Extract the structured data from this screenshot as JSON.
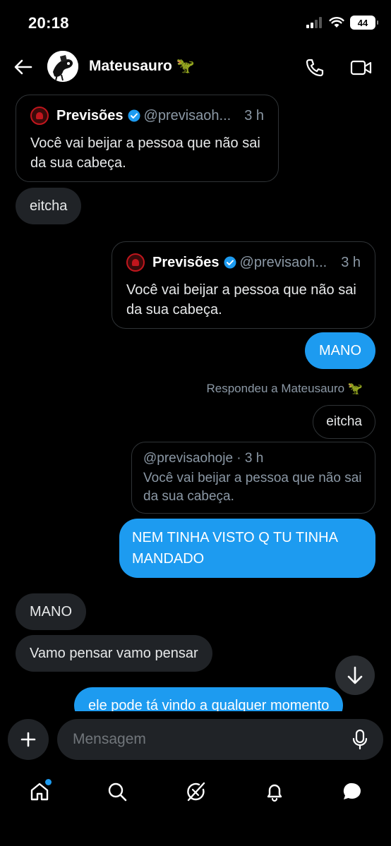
{
  "status_bar": {
    "time": "20:18",
    "battery": "44"
  },
  "header": {
    "contact_name": "Mateusauro 🦖"
  },
  "messages": {
    "quote1": {
      "name": "Previsões",
      "handle": "@previsaoh...",
      "time": "3 h",
      "text": "Você vai beijar a pessoa que não sai da sua cabeça."
    },
    "in_eitcha": "eitcha",
    "quote2": {
      "name": "Previsões",
      "handle": "@previsaoh...",
      "time": "3 h",
      "text": "Você vai beijar a pessoa que não sai da sua cabeça."
    },
    "out_mano": "MANO",
    "reply_label": "Respondeu a Mateusauro 🦖",
    "replied_eitcha": "eitcha",
    "quote3": {
      "handle_time": "@previsaohoje · 3 h",
      "text": "Você vai beijar a pessoa que não sai da sua cabeça."
    },
    "out_nem_tinha": "NEM TINHA VISTO Q TU TINHA MANDADO",
    "in_mano": "MANO",
    "in_vamo": "Vamo pensar vamo pensar",
    "out_ele_pode": "ele pode tá vindo a qualquer momento"
  },
  "composer": {
    "placeholder": "Mensagem"
  },
  "tabs": [
    "home",
    "search",
    "grok",
    "notifications",
    "messages"
  ],
  "colors": {
    "accent": "#1d9bf0",
    "bubble_in": "#202327",
    "background": "#000000"
  }
}
